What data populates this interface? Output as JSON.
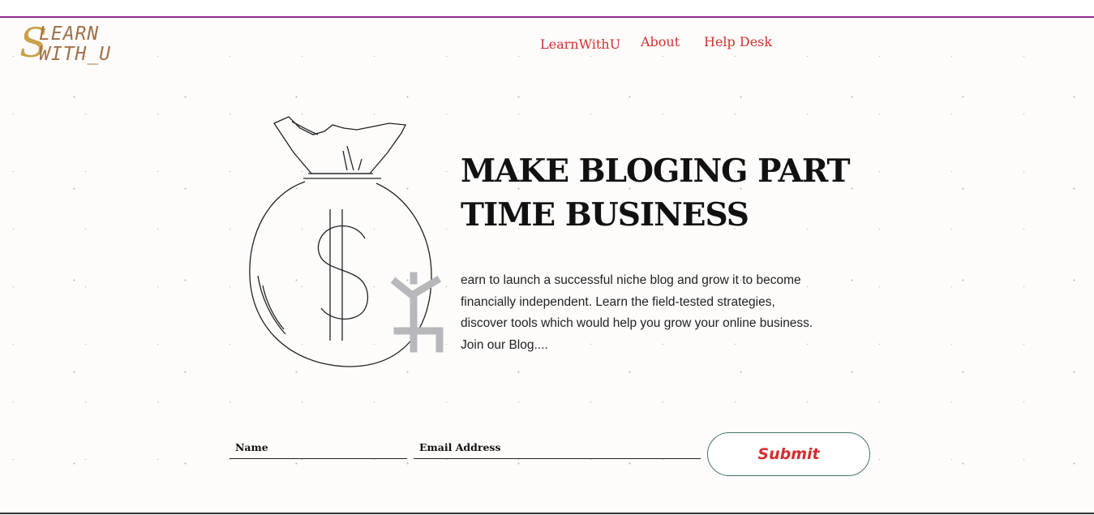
{
  "logo": {
    "s_letter": "S",
    "line1": "LEARN",
    "line2": "WITH_U",
    "colors": {
      "s": "#c9a24a",
      "text": "#a0714a"
    }
  },
  "nav": {
    "items": [
      {
        "label": "LearnWithU"
      },
      {
        "label": "About"
      },
      {
        "label": "Help Desk"
      }
    ],
    "color": "#d32f2f"
  },
  "hero": {
    "illustration": "money-bag-icon",
    "headline_line1": "MAKE BLOGING PART",
    "headline_line2": "TIME BUSINESS",
    "desc_line1": "earn to launch a successful niche blog and grow it to become",
    "desc_line2": "financially independent. Learn the field-tested strategies,",
    "desc_line3": "discover tools which would help you grow your online business.",
    "desc_line4": "Join our Blog...."
  },
  "form": {
    "name_placeholder": "Name",
    "email_placeholder": "Email Address",
    "submit_label": "Submit"
  },
  "colors": {
    "accent": "#d32f2f",
    "top_border": "#8e2c8f",
    "button_border": "#3f7a6a"
  }
}
